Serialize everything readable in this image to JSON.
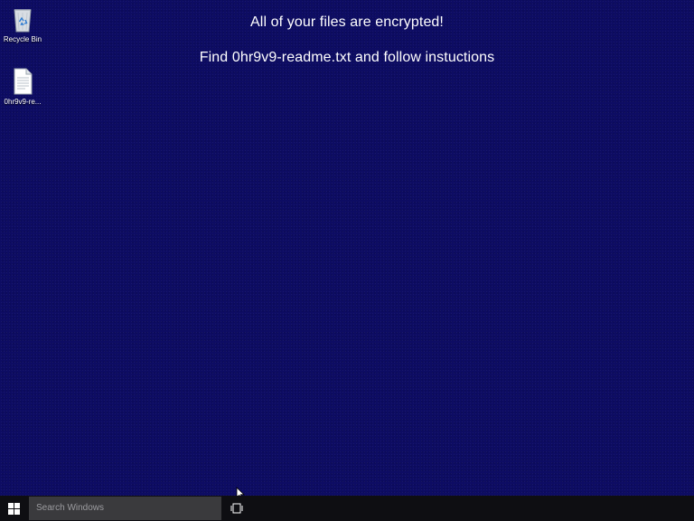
{
  "desktop": {
    "background_color": "#0d0c63",
    "message": {
      "line1": "All of your files are encrypted!",
      "line2": "Find 0hr9v9-readme.txt and follow instuctions"
    },
    "icons": [
      {
        "label": "Recycle Bin",
        "icon": "recycle-bin-icon"
      },
      {
        "label": "0hr9v9-re...",
        "icon": "text-file-icon"
      }
    ]
  },
  "taskbar": {
    "start_icon": "windows-logo-icon",
    "search_placeholder": "Search Windows",
    "task_view_icon": "task-view-icon"
  }
}
